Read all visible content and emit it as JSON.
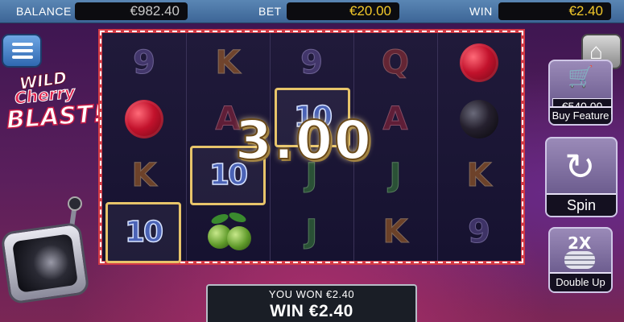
{
  "topbar": {
    "balance_label": "BALANCE",
    "balance_value": "€982.40",
    "bet_label": "BET",
    "bet_value": "€20.00",
    "win_label": "WIN",
    "win_value": "€2.40"
  },
  "logo": {
    "line1": "WILD",
    "line2": "Cherry",
    "line3": "BLAST!"
  },
  "reels": [
    [
      "9",
      "raspberry",
      "K",
      "10"
    ],
    [
      "K",
      "A",
      "10",
      "gooseberry"
    ],
    [
      "9",
      "10",
      "J",
      "J"
    ],
    [
      "Q",
      "A",
      "J",
      "K"
    ],
    [
      "raspberry",
      "blackberry",
      "K",
      "9"
    ]
  ],
  "win_amount_overlay": "3.00",
  "buttons": {
    "home_icon": "home-icon",
    "buy_feature_price": "€540.00",
    "buy_feature_label": "Buy Feature",
    "spin_label": "Spin",
    "double_up_icon_text": "2X",
    "double_up_label": "Double Up"
  },
  "win_panel": {
    "you_won": "YOU WON €2.40",
    "win_text": "WIN €2.40"
  },
  "colors": {
    "top_bar": "#4a76a8",
    "gold_value": "#f3c92a",
    "reel_border": "#d33a45",
    "win_box": "#e7c46a"
  }
}
